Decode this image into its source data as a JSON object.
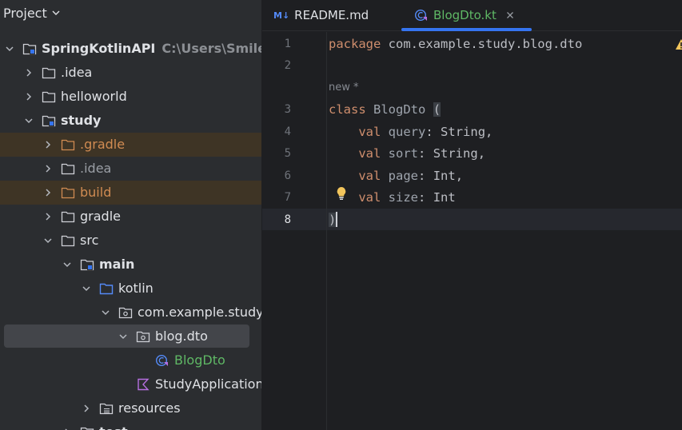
{
  "panel": {
    "title": "Project",
    "tree": [
      {
        "label": "SpringKotlinAPI",
        "hint": "C:\\Users\\SmileB\\",
        "icon": "module-folder-icon",
        "expanded": true,
        "bold": true
      },
      {
        "label": ".idea",
        "icon": "folder-icon",
        "expanded": false
      },
      {
        "label": "helloworld",
        "icon": "folder-icon",
        "expanded": false
      },
      {
        "label": "study",
        "icon": "module-folder-icon",
        "expanded": true,
        "bold": true
      },
      {
        "label": ".gradle",
        "icon": "excluded-folder-icon",
        "expanded": false
      },
      {
        "label": ".idea",
        "icon": "folder-icon",
        "expanded": false
      },
      {
        "label": "build",
        "icon": "excluded-folder-icon",
        "expanded": false
      },
      {
        "label": "gradle",
        "icon": "folder-icon",
        "expanded": false
      },
      {
        "label": "src",
        "icon": "folder-icon",
        "expanded": true
      },
      {
        "label": "main",
        "icon": "module-folder-icon",
        "expanded": true,
        "bold": true
      },
      {
        "label": "kotlin",
        "icon": "source-folder-icon",
        "expanded": true
      },
      {
        "label": "com.example.study",
        "icon": "package-icon",
        "expanded": true
      },
      {
        "label": "blog.dto",
        "icon": "package-icon",
        "expanded": true,
        "selected": true
      },
      {
        "label": "BlogDto",
        "icon": "kotlin-class-icon"
      },
      {
        "label": "StudyApplication.",
        "icon": "kotlin-file-icon"
      },
      {
        "label": "resources",
        "icon": "resources-folder-icon",
        "expanded": false
      },
      {
        "label": "test",
        "icon": "folder-icon",
        "expanded": false
      }
    ]
  },
  "tabs": [
    {
      "label": "README.md",
      "icon": "markdown-icon"
    },
    {
      "label": "BlogDto.kt",
      "icon": "kotlin-class-icon",
      "active": true,
      "closable": true
    }
  ],
  "editor": {
    "inlay_hint": "new *",
    "current_line": 8,
    "lines": [
      {
        "num": "1",
        "text": "package com.example.study.blog.dto"
      },
      {
        "num": "2",
        "text": ""
      },
      {
        "num": "3",
        "text": "class BlogDto ("
      },
      {
        "num": "4",
        "text": "    val query: String,"
      },
      {
        "num": "5",
        "text": "    val sort: String,"
      },
      {
        "num": "6",
        "text": "    val page: Int,"
      },
      {
        "num": "7",
        "text": "    val size: Int"
      },
      {
        "num": "8",
        "text": ")"
      }
    ],
    "gutter_icon": "lightbulb-icon",
    "warning_icon": "warning-icon"
  },
  "colors": {
    "panel_bg": "#2b2d30",
    "editor_bg": "#1e1f22",
    "accent": "#3574f0",
    "keyword": "#cf8e6d",
    "excluded_text": "#d08b52",
    "class_file_text": "#5fb865"
  }
}
